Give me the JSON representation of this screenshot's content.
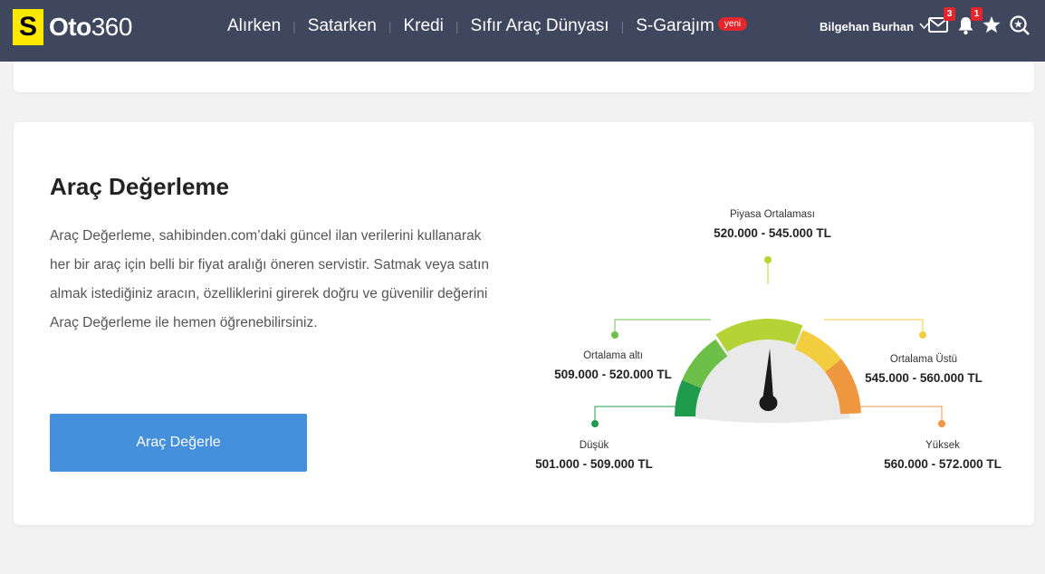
{
  "header": {
    "logo_letter": "S",
    "logo_oto": "Oto",
    "logo_num": "360",
    "nav": [
      {
        "label": "Alırken"
      },
      {
        "label": "Satarken"
      },
      {
        "label": "Kredi"
      },
      {
        "label": "Sıfır Araç Dünyası"
      },
      {
        "label": "S-Garajım",
        "badge": "yeni"
      }
    ],
    "user_name": "Bilgehan Burhan",
    "messages_count": "3",
    "notifications_count": "1"
  },
  "valuation": {
    "title": "Araç Değerleme",
    "description": "Araç Değerleme, sahibinden.com’daki güncel ilan verilerini kullanarak her bir araç için belli bir fiyat aralığı öneren servistir. Satmak veya satın almak istediğiniz aracın, özelliklerini girerek doğru ve güvenilir değerini Araç Değerleme ile hemen öğrenebilirsiniz.",
    "button_label": "Araç Değerle"
  },
  "gauge": {
    "segments": [
      {
        "name": "low",
        "title": "Düşük",
        "range": "501.000 - 509.000 TL",
        "color": "#1e9b4b"
      },
      {
        "name": "below-average",
        "title": "Ortalama altı",
        "range": "509.000 - 520.000 TL",
        "color": "#6cc04a"
      },
      {
        "name": "market-average",
        "title": "Piyasa Ortalaması",
        "range": "520.000 - 545.000 TL",
        "color": "#b5d334"
      },
      {
        "name": "above-average",
        "title": "Ortalama Üstü",
        "range": "545.000 - 560.000 TL",
        "color": "#f2cd40"
      },
      {
        "name": "high",
        "title": "Yüksek",
        "range": "560.000 - 572.000 TL",
        "color": "#ef973f"
      }
    ]
  }
}
